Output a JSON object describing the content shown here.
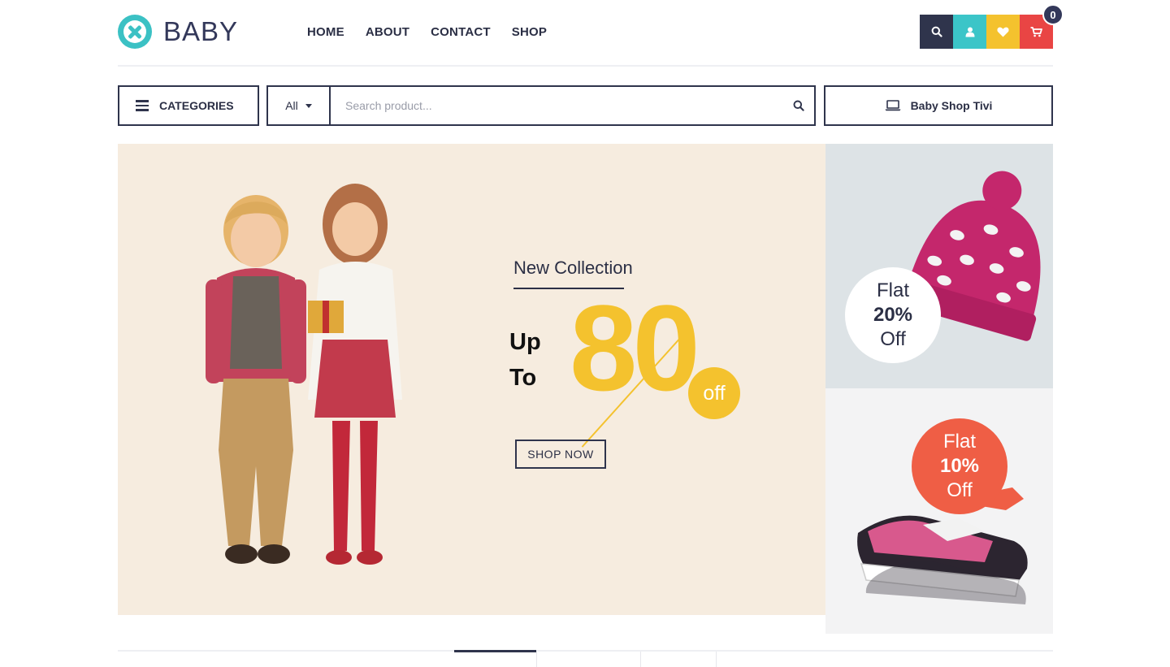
{
  "brand": {
    "name": "BABY"
  },
  "nav": {
    "items": [
      "HOME",
      "ABOUT",
      "CONTACT",
      "SHOP"
    ]
  },
  "header_actions": {
    "icons": [
      "search-icon",
      "user-icon",
      "heart-icon",
      "cart-icon"
    ],
    "cart_count": "0"
  },
  "categories": {
    "label": "CATEGORIES"
  },
  "search": {
    "category": "All",
    "placeholder": "Search product..."
  },
  "tv_link": {
    "label": "Baby Shop Tivi"
  },
  "hero": {
    "eyebrow": "New Collection",
    "up": "Up",
    "to": "To",
    "value": "80",
    "off": "off",
    "cta": "SHOP NOW"
  },
  "promos": [
    {
      "line1": "Flat",
      "percent": "20%",
      "line2": "Off"
    },
    {
      "line1": "Flat",
      "percent": "10%",
      "line2": "Off"
    }
  ],
  "colors": {
    "navy": "#2f344c",
    "teal": "#3bc5c8",
    "yellow": "#f4c22e",
    "red": "#e94544",
    "coral": "#ef5e45",
    "hero_bg": "#f6ecdf"
  }
}
